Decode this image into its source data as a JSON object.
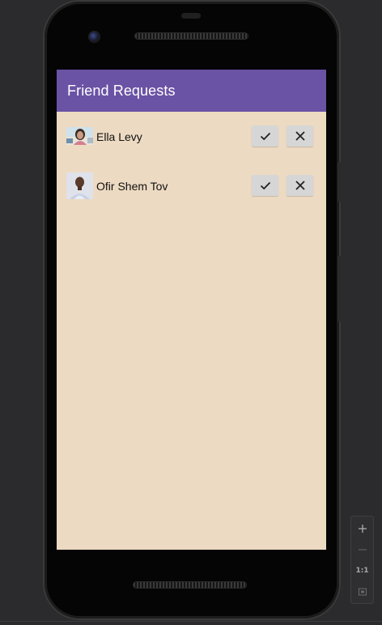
{
  "app": {
    "title": "Friend Requests",
    "colors": {
      "app_bar": "#6a52a4",
      "background": "#eddac2",
      "action_button": "#d6d6d6"
    }
  },
  "requests": [
    {
      "name": "Ella Levy",
      "avatar": "profile-photo",
      "accept_icon": "check-icon",
      "decline_icon": "close-icon"
    },
    {
      "name": "Ofir Shem Tov",
      "avatar": "profile-photo",
      "accept_icon": "check-icon",
      "decline_icon": "close-icon"
    }
  ],
  "emulator_controls": {
    "zoom_in_icon": "plus-icon",
    "zoom_out_icon": "minus-icon",
    "actual_size_label": "1:1",
    "fit_screen_icon": "fit-screen-icon"
  }
}
